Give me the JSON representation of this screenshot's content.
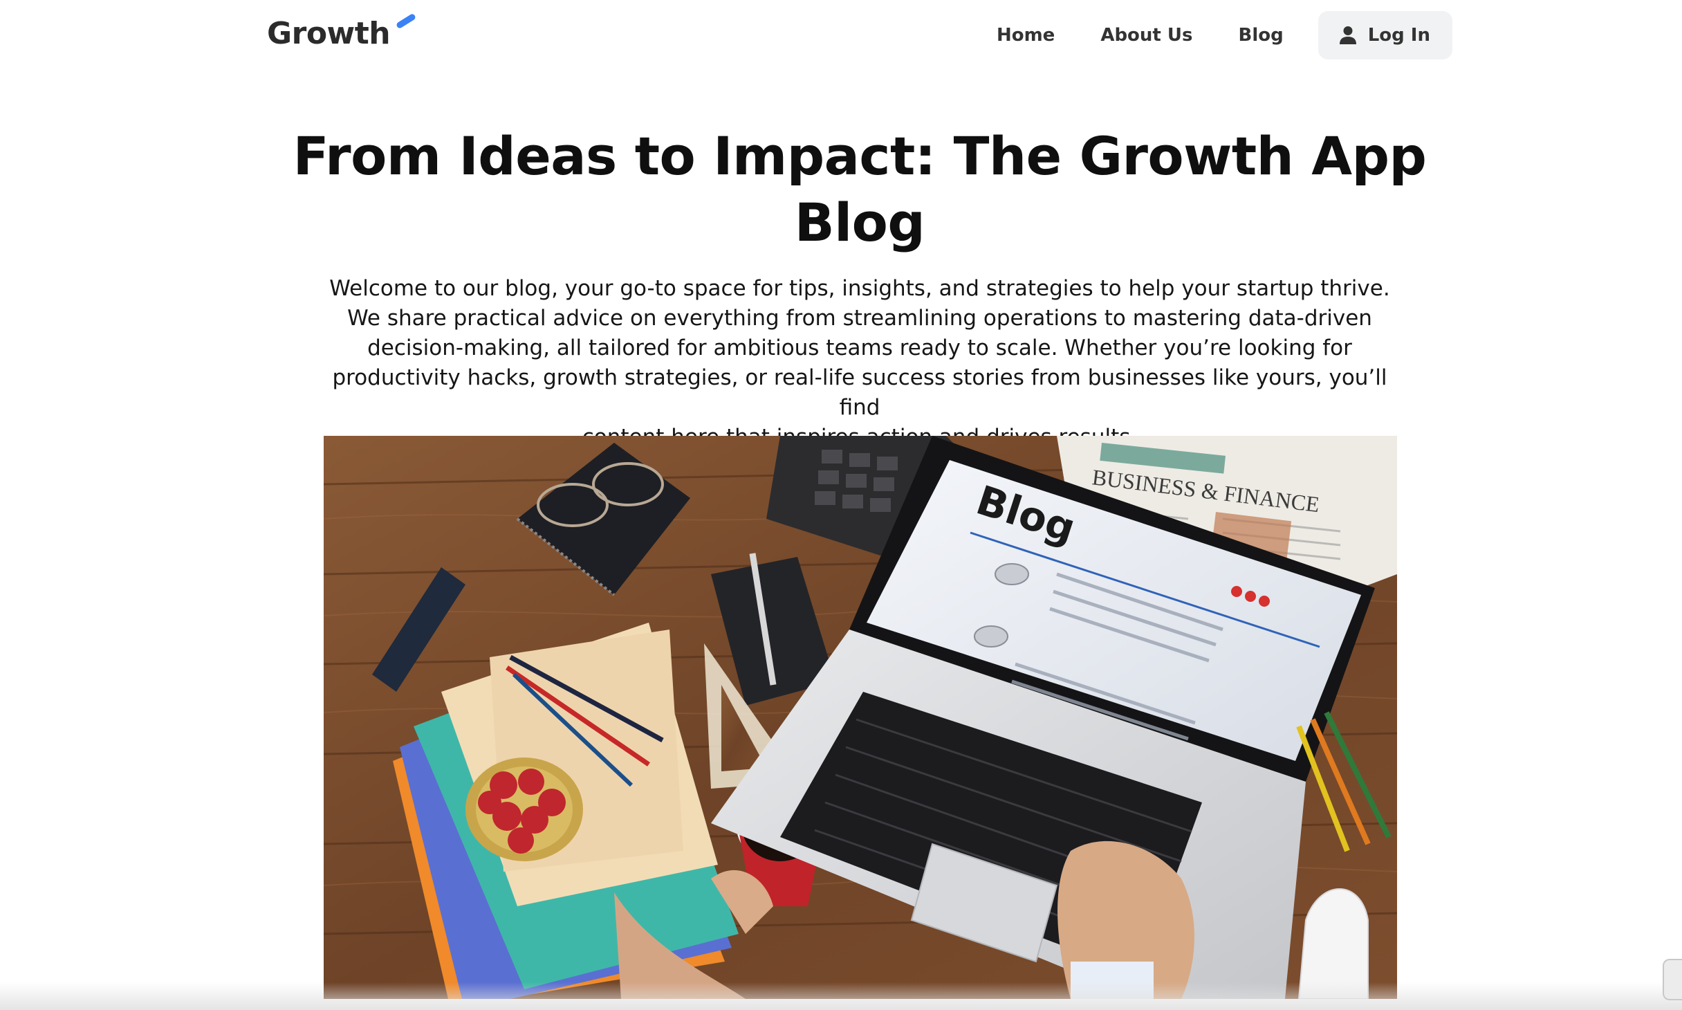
{
  "header": {
    "logo_text": "Growth",
    "nav": {
      "home": "Home",
      "about": "About Us",
      "blog": "Blog"
    },
    "login_label": "Log In"
  },
  "hero": {
    "title_line1": "From Ideas to Impact: The Growth App",
    "title_line2": "Blog",
    "intro_lines": [
      "Welcome to our blog, your go-to space for tips, insights, and strategies to help your startup thrive.",
      "We share practical advice on everything from streamlining operations to mastering data-driven",
      "decision-making, all tailored for ambitious teams ready to scale. Whether you’re looking for",
      "productivity hacks, growth strategies, or real-life success stories from businesses like yours, you’ll find",
      "content here that inspires action and drives results."
    ]
  },
  "image": {
    "screen_heading": "Blog",
    "newspaper_heading": "BUSINESS & FINANCE"
  },
  "colors": {
    "brand_accent": "#3b82f6",
    "login_bg": "#f1f2f3",
    "text": "#111111"
  },
  "icons": {
    "login": "user-icon"
  }
}
